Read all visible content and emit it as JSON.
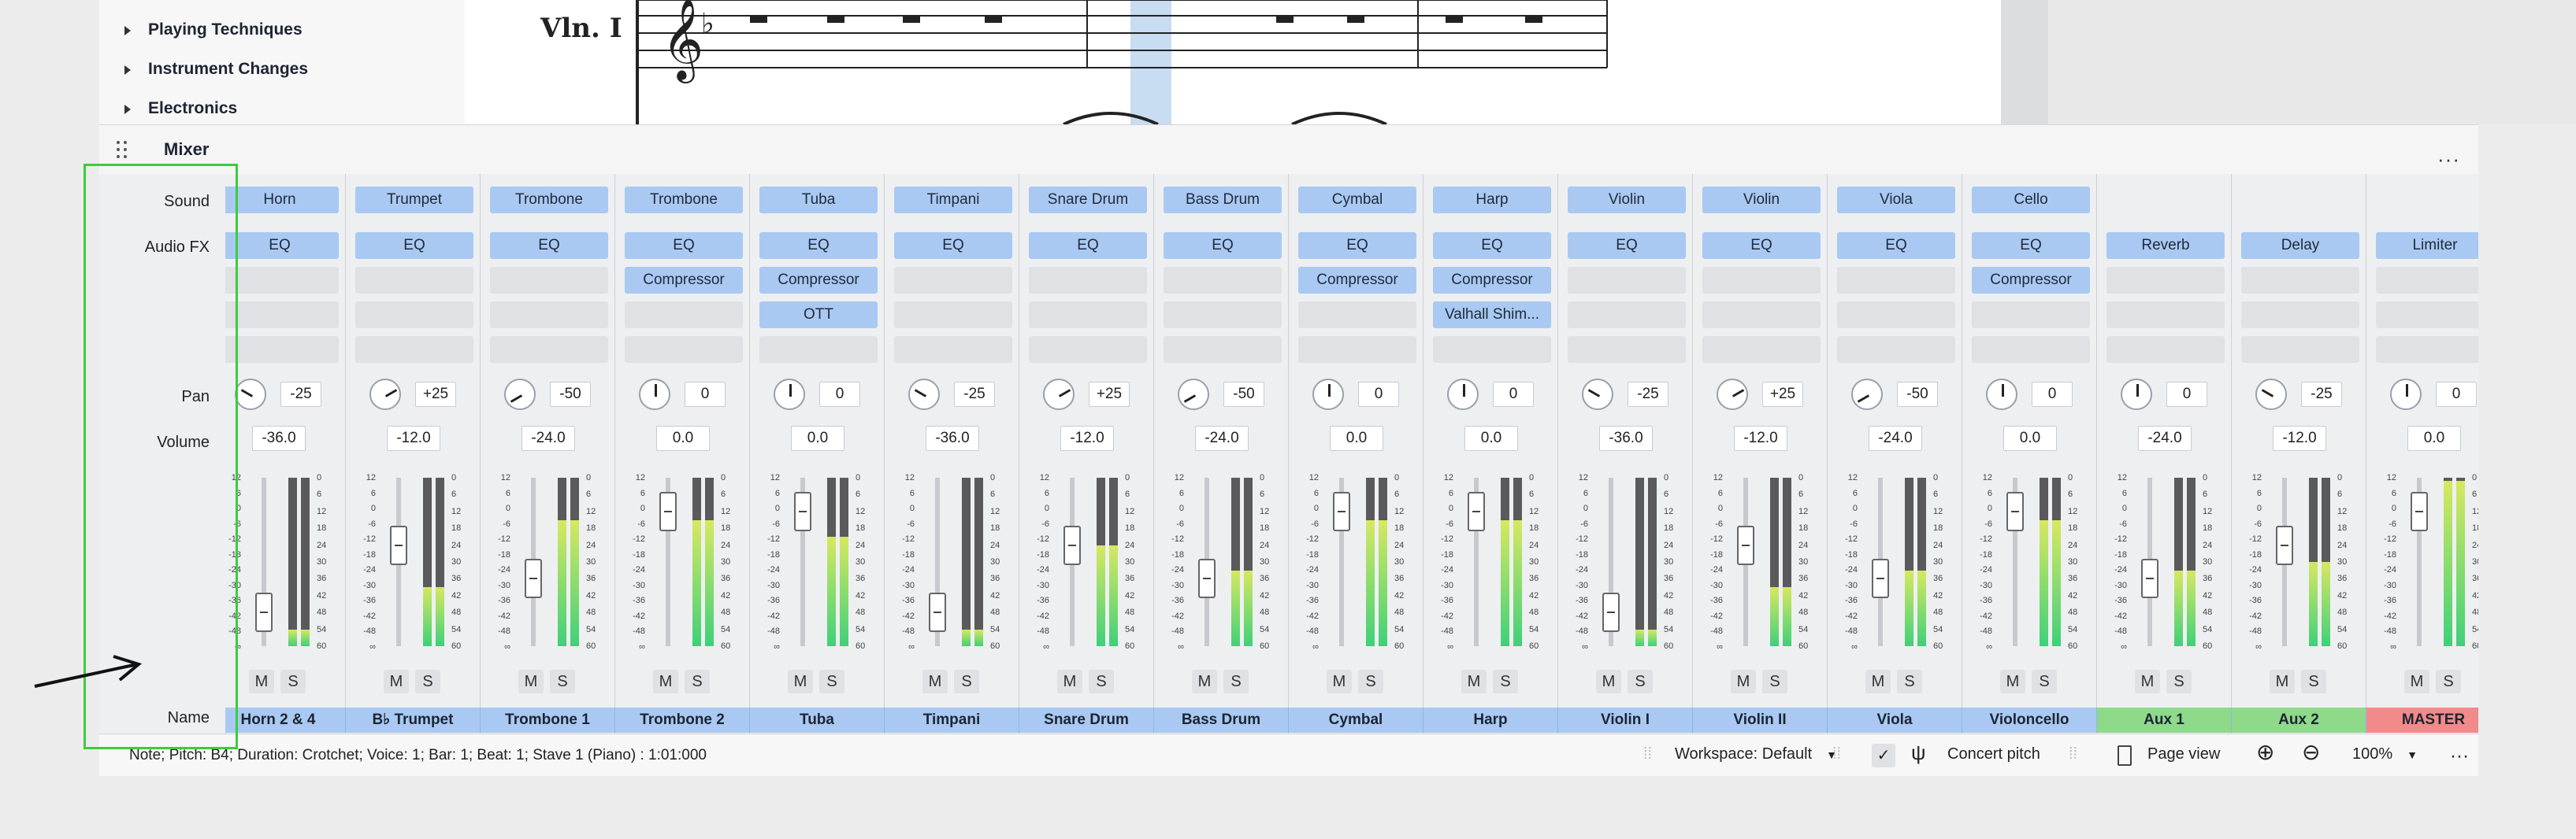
{
  "palette": {
    "items": [
      "Playing Techniques",
      "Instrument Changes",
      "Electronics"
    ]
  },
  "score": {
    "staff_label": "Vln. I"
  },
  "mixer": {
    "title": "Mixer",
    "more": "···",
    "row_labels": {
      "sound": "Sound",
      "audio_fx": "Audio FX",
      "pan": "Pan",
      "volume": "Volume",
      "name": "Name"
    },
    "mute_label": "M",
    "solo_label": "S",
    "meter_scale": [
      "12",
      "6",
      "0",
      "-6",
      "-12",
      "-18",
      "-24",
      "-30",
      "-36",
      "-42",
      "-48",
      "∞"
    ],
    "peak_scale": [
      "0",
      "6",
      "12",
      "18",
      "24",
      "30",
      "36",
      "42",
      "48",
      "54",
      "60"
    ],
    "strips": [
      {
        "name": "Horn 2 & 4",
        "sound": "Horn",
        "fx": [
          "EQ"
        ],
        "pan": "-25",
        "volume": "-36.0",
        "level": 0.1,
        "color": "blue"
      },
      {
        "name": "B♭ Trumpet",
        "sound": "Trumpet",
        "fx": [
          "EQ"
        ],
        "pan": "+25",
        "volume": "-12.0",
        "level": 0.35,
        "color": "blue"
      },
      {
        "name": "Trombone 1",
        "sound": "Trombone",
        "fx": [
          "EQ"
        ],
        "pan": "-50",
        "volume": "-24.0",
        "level": 0.75,
        "color": "blue"
      },
      {
        "name": "Trombone 2",
        "sound": "Trombone",
        "fx": [
          "EQ",
          "Compressor"
        ],
        "pan": "0",
        "volume": "0.0",
        "level": 0.75,
        "color": "blue"
      },
      {
        "name": "Tuba",
        "sound": "Tuba",
        "fx": [
          "EQ",
          "Compressor",
          "OTT"
        ],
        "pan": "0",
        "volume": "0.0",
        "level": 0.65,
        "color": "blue"
      },
      {
        "name": "Timpani",
        "sound": "Timpani",
        "fx": [
          "EQ"
        ],
        "pan": "-25",
        "volume": "-36.0",
        "level": 0.1,
        "color": "blue"
      },
      {
        "name": "Snare Drum",
        "sound": "Snare Drum",
        "fx": [
          "EQ"
        ],
        "pan": "+25",
        "volume": "-12.0",
        "level": 0.6,
        "color": "blue"
      },
      {
        "name": "Bass Drum",
        "sound": "Bass Drum",
        "fx": [
          "EQ"
        ],
        "pan": "-50",
        "volume": "-24.0",
        "level": 0.45,
        "color": "blue"
      },
      {
        "name": "Cymbal",
        "sound": "Cymbal",
        "fx": [
          "EQ",
          "Compressor"
        ],
        "pan": "0",
        "volume": "0.0",
        "level": 0.75,
        "color": "blue"
      },
      {
        "name": "Harp",
        "sound": "Harp",
        "fx": [
          "EQ",
          "Compressor",
          "Valhall Shim..."
        ],
        "pan": "0",
        "volume": "0.0",
        "level": 0.75,
        "color": "blue"
      },
      {
        "name": "Violin I",
        "sound": "Violin",
        "fx": [
          "EQ"
        ],
        "pan": "-25",
        "volume": "-36.0",
        "level": 0.1,
        "color": "blue"
      },
      {
        "name": "Violin II",
        "sound": "Violin",
        "fx": [
          "EQ"
        ],
        "pan": "+25",
        "volume": "-12.0",
        "level": 0.35,
        "color": "blue"
      },
      {
        "name": "Viola",
        "sound": "Viola",
        "fx": [
          "EQ"
        ],
        "pan": "-50",
        "volume": "-24.0",
        "level": 0.45,
        "color": "blue"
      },
      {
        "name": "Violoncello",
        "sound": "Cello",
        "fx": [
          "EQ",
          "Compressor"
        ],
        "pan": "0",
        "volume": "0.0",
        "level": 0.75,
        "color": "blue"
      },
      {
        "name": "Aux 1",
        "sound": "",
        "fx": [
          "Reverb"
        ],
        "pan": "0",
        "volume": "-24.0",
        "level": 0.45,
        "color": "green"
      },
      {
        "name": "Aux 2",
        "sound": "",
        "fx": [
          "Delay"
        ],
        "pan": "-25",
        "volume": "-12.0",
        "level": 0.5,
        "color": "green"
      },
      {
        "name": "MASTER",
        "sound": "",
        "fx": [
          "Limiter"
        ],
        "pan": "0",
        "volume": "0.0",
        "level": 0.98,
        "color": "red"
      }
    ]
  },
  "status": {
    "text": "Note; Pitch: B4; Duration: Crotchet; Voice: 1; Bar: 1; Beat: 1; Stave 1 (Piano) :  1:01:000",
    "workspace": "Workspace: Default",
    "concert_pitch": "Concert pitch",
    "page_view": "Page view",
    "zoom": "100%",
    "more": "···"
  },
  "colors": {
    "slot_on": "#a9c9f2",
    "name_blue": "#a9c9f2",
    "name_green": "#8ed98a",
    "name_red": "#f28a8a",
    "annotation": "#3ecb3e"
  }
}
